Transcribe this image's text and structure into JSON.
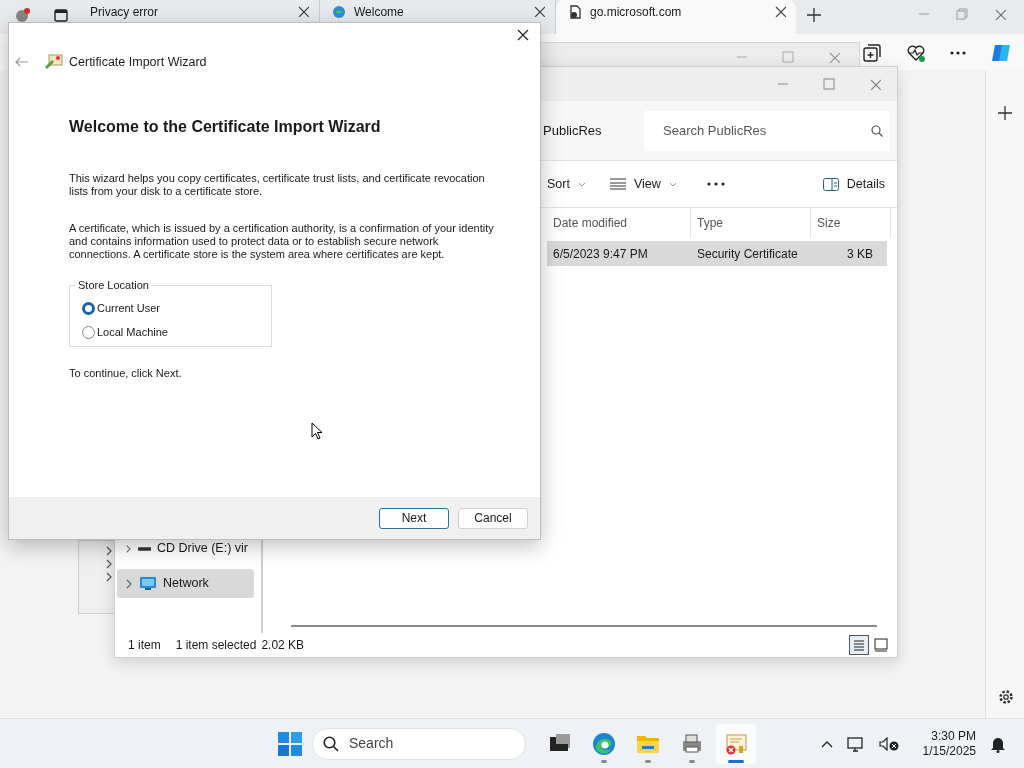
{
  "browser": {
    "tabs": [
      {
        "label": "Privacy error",
        "selected": false
      },
      {
        "label": "Welcome",
        "selected": false
      },
      {
        "label": "go.microsoft.com",
        "selected": true
      }
    ]
  },
  "explorer": {
    "breadcrumb": "PublicRes",
    "search": {
      "placeholder": "Search PublicRes"
    },
    "sort_label": "Sort",
    "view_label": "View",
    "details_label": "Details",
    "columns": [
      "Date modified",
      "Type",
      "Size"
    ],
    "rows": [
      {
        "cells": [
          "6/5/2023 9:47 PM",
          "Security Certificate",
          "3 KB"
        ],
        "selected": true
      }
    ],
    "nav": [
      {
        "label": "CD Drive (E:) vir",
        "kind": "drive",
        "selected": false
      },
      {
        "label": "Network",
        "kind": "network",
        "selected": true
      }
    ],
    "status": {
      "count": "1 item",
      "selection": "1 item selected",
      "size": "2.02 KB"
    }
  },
  "wizard": {
    "title": "Certificate Import Wizard",
    "heading": "Welcome to the Certificate Import Wizard",
    "paragraphs": [
      "This wizard helps you copy certificates, certificate trust lists, and certificate revocation lists from your disk to a certificate store.",
      "A certificate, which is issued by a certification authority, is a confirmation of your identity and contains information used to protect data or to establish secure network connections. A certificate store is the system area where certificates are kept."
    ],
    "group": {
      "legend": "Store Location",
      "options": [
        {
          "label": "Current User",
          "selected": true
        },
        {
          "label": "Local Machine",
          "selected": false
        }
      ]
    },
    "hint": "To continue, click Next.",
    "buttons": [
      {
        "label": "Next",
        "default": true
      },
      {
        "label": "Cancel",
        "default": false
      }
    ]
  },
  "taskbar": {
    "search_placeholder": "Search",
    "apps": [
      {
        "kind": "taskview",
        "running": false,
        "active": false
      },
      {
        "kind": "edge",
        "running": true,
        "active": false
      },
      {
        "kind": "files",
        "running": true,
        "active": false
      },
      {
        "kind": "app",
        "running": true,
        "active": false
      },
      {
        "kind": "certificate",
        "running": true,
        "active": true
      }
    ],
    "time": "3:30 PM",
    "date": "1/15/2025"
  }
}
